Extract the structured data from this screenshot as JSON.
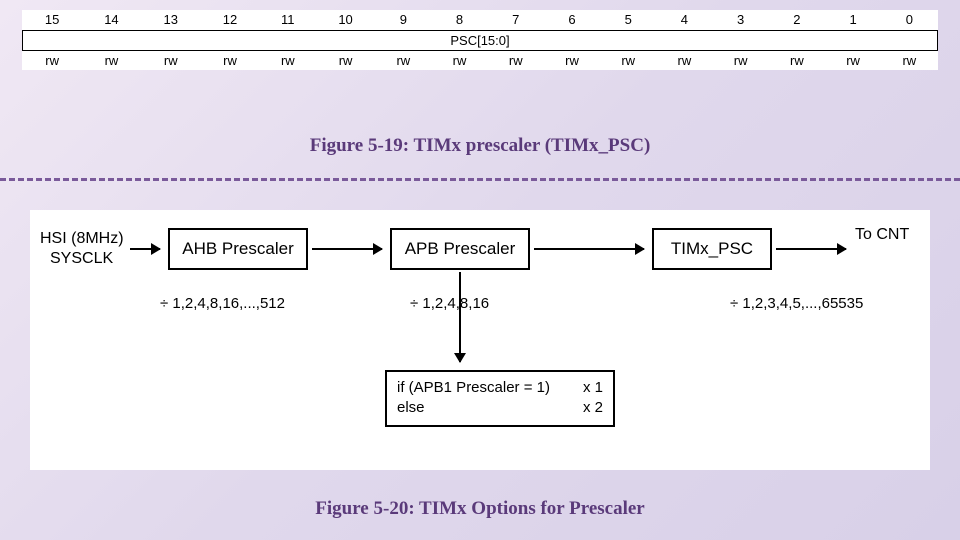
{
  "register": {
    "bits": [
      "15",
      "14",
      "13",
      "12",
      "11",
      "10",
      "9",
      "8",
      "7",
      "6",
      "5",
      "4",
      "3",
      "2",
      "1",
      "0"
    ],
    "field": "PSC[15:0]",
    "access": [
      "rw",
      "rw",
      "rw",
      "rw",
      "rw",
      "rw",
      "rw",
      "rw",
      "rw",
      "rw",
      "rw",
      "rw",
      "rw",
      "rw",
      "rw",
      "rw"
    ]
  },
  "caption1": "Figure 5-19: TIMx prescaler (TIMx_PSC)",
  "caption2": "Figure 5-20: TIMx Options for Prescaler",
  "diagram": {
    "input1": "HSI (8MHz)",
    "input2": "SYSCLK",
    "box1": "AHB Prescaler",
    "box2": "APB Prescaler",
    "box3": "TIMx_PSC",
    "out": "To CNT",
    "div1": "÷ 1,2,4,8,16,...,512",
    "div2": "÷ 1,2,4,8,16",
    "div3": "÷ 1,2,3,4,5,...,65535",
    "condL1a": "if (APB1 Prescaler = 1)",
    "condL1b": "x 1",
    "condL2a": "else",
    "condL2b": "x 2"
  },
  "chart_data": {
    "type": "diagram",
    "nodes": [
      {
        "id": "in",
        "label": "HSI (8MHz) SYSCLK"
      },
      {
        "id": "ahb",
        "label": "AHB Prescaler",
        "divisors": [
          1,
          2,
          4,
          8,
          16,
          512
        ],
        "range": "1..512 powers of 2"
      },
      {
        "id": "apb",
        "label": "APB Prescaler",
        "divisors": [
          1,
          2,
          4,
          8,
          16
        ]
      },
      {
        "id": "cond",
        "label": "if (APB1 Prescaler = 1) x1 else x2"
      },
      {
        "id": "psc",
        "label": "TIMx_PSC",
        "divisors_range": [
          1,
          65535
        ]
      },
      {
        "id": "out",
        "label": "To CNT"
      }
    ],
    "edges": [
      [
        "in",
        "ahb"
      ],
      [
        "ahb",
        "apb"
      ],
      [
        "apb",
        "psc"
      ],
      [
        "apb",
        "cond"
      ],
      [
        "psc",
        "out"
      ]
    ]
  }
}
